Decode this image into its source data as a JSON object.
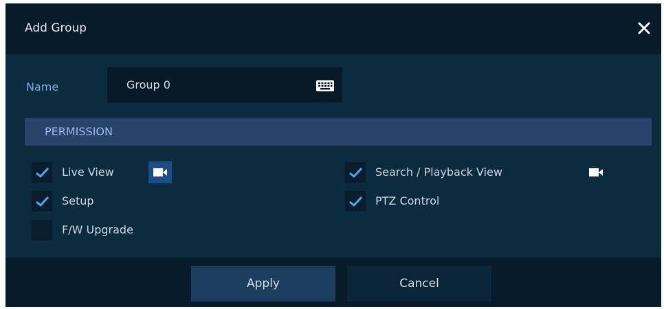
{
  "dialog": {
    "title": "Add Group",
    "close_icon": "close-icon"
  },
  "name_field": {
    "label": "Name",
    "value": "Group 0",
    "keyboard_icon": "keyboard-icon"
  },
  "permission": {
    "header": "PERMISSION",
    "items": [
      {
        "label": "Live View",
        "checked": true,
        "camera_icon": "camera-icon"
      },
      {
        "label": "Search / Playback View",
        "checked": true,
        "camera_icon": "camera-icon"
      },
      {
        "label": "Setup",
        "checked": true
      },
      {
        "label": "PTZ Control",
        "checked": true
      },
      {
        "label": "F/W Upgrade",
        "checked": false
      }
    ]
  },
  "buttons": {
    "apply_label": "Apply",
    "cancel_label": "Cancel"
  },
  "colors": {
    "dialog_bg": "#0b2b3f",
    "titlebar_bg": "#081b2a",
    "accent_blue": "#4aa8f0",
    "section_header_bg": "#27446a",
    "label_blue": "#7fa8f0"
  }
}
